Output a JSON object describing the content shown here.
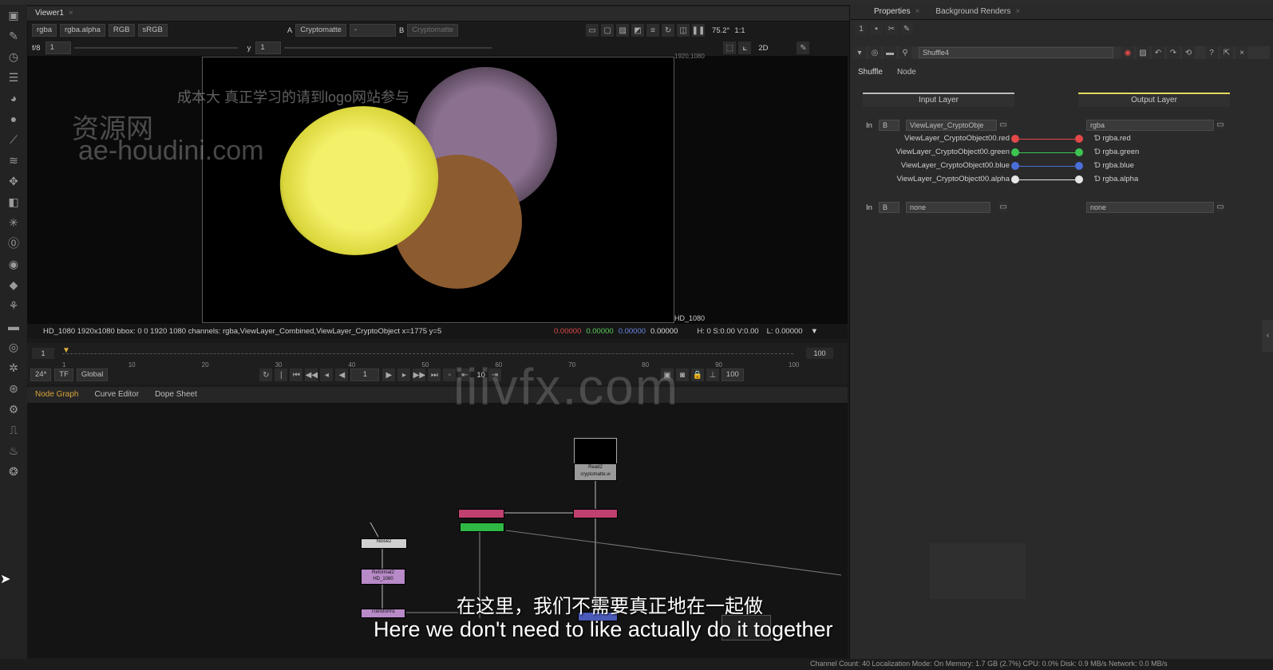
{
  "viewer": {
    "tab_label": "Viewer1",
    "channels": "rgba",
    "alpha": "rgba.alpha",
    "display": "RGB",
    "lut": "sRGB",
    "a_label": "A",
    "a_value": "Cryptomatte",
    "a_dash": "-",
    "b_label": "B",
    "b_value": "Cryptomatte",
    "zoom": "75.2°",
    "ratio": "1:1",
    "fstop": "f/8",
    "gain_value": "1",
    "gamma_label": "y",
    "gamma_value": "1",
    "view_mode": "2D",
    "format_corner": "1920,1080",
    "format_label": "HD_1080"
  },
  "info_bar": {
    "text": "HD_1080 1920x1080  bbox: 0 0 1920 1080 channels: rgba,ViewLayer_Combined,ViewLayer_CryptoObject  x=1775 y=5",
    "r": "0.00000",
    "g": "0.00000",
    "b": "0.00000",
    "a": "0.00000",
    "hsv": "H:  0 S:0.00 V:0.00",
    "luma": "L: 0.00000"
  },
  "timeline": {
    "ticks": [
      "1",
      "10",
      "20",
      "30",
      "40",
      "50",
      "60",
      "70",
      "80",
      "90",
      "100"
    ],
    "start_frame": "1",
    "end_frame": "100",
    "end_frame_2": "100",
    "fps": "24*",
    "tf": "TF",
    "scope": "Global",
    "current_frame": "1",
    "step": "10"
  },
  "node_graph_tabs": [
    "Node Graph",
    "Curve Editor",
    "Dope Sheet"
  ],
  "nodes": {
    "read_label": "Read2",
    "read_sub": "cryptomatte.w",
    "noise_label": "Noise2",
    "reformat_label": "Reformat2",
    "reformat_sub": "HD_1080",
    "transform_label": "Transform1"
  },
  "properties": {
    "tabs": [
      "Properties",
      "Background Renders"
    ],
    "node_name": "Shuffle4",
    "subtabs": [
      "Shuffle",
      "Node"
    ],
    "input_layer": "Input Layer",
    "output_layer": "Output Layer",
    "in_label": "In",
    "in_b": "B",
    "input_layer_value": "ViewLayer_CryptoObje",
    "output_layer_value": "rgba",
    "in_channels": [
      "ViewLayer_CryptoObject00.red",
      "ViewLayer_CryptoObject00.green",
      "ViewLayer_CryptoObject00.blue",
      "ViewLayer_CryptoObject00.alpha"
    ],
    "out_channels": [
      "rgba.red",
      "rgba.green",
      "rgba.blue",
      "rgba.alpha"
    ],
    "in2_b": "B",
    "in2_value": "none",
    "out2_value": "none",
    "channel_colors": [
      "#e24848",
      "#3cc452",
      "#4a6fd8",
      "#e6e6e6"
    ]
  },
  "status_bar": "Channel Count: 40  Localization Mode: On  Memory: 1.7 GB (2.7%)  CPU: 0.0%  Disk: 0.9 MB/s  Network: 0.0 MB/s",
  "watermarks": {
    "chinese_top": "成本大 真正学习的请到logo网站参与",
    "site_cn": "资源网",
    "site_url": "ae-houdini.com",
    "center": "iiivfx.com"
  },
  "subtitles": {
    "zh": "在这里，我们不需要真正地在一起做",
    "en": "Here we don't need to like actually do it together"
  }
}
